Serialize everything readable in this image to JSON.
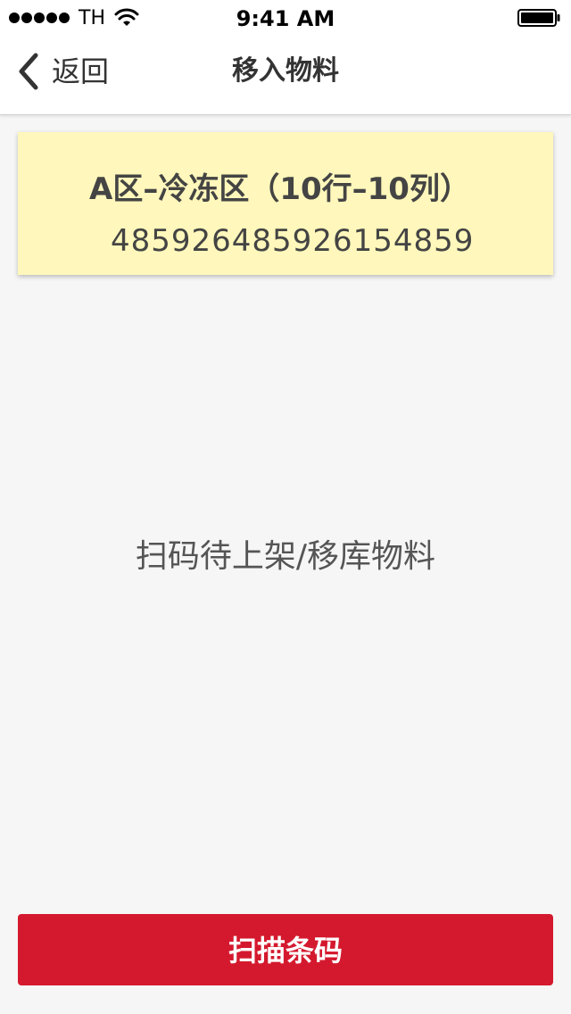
{
  "status_bar": {
    "carrier": "TH",
    "time": "9:41 AM"
  },
  "nav": {
    "back_label": "返回",
    "title": "移入物料"
  },
  "location": {
    "title": "A区–冷冻区（10行–10列）",
    "code": "485926485926154859"
  },
  "hint": "扫码待上架/移库物料",
  "scan_button_label": "扫描条码",
  "colors": {
    "card_bg": "#fff7bb",
    "primary": "#d4192e",
    "page_bg": "#f6f6f6"
  },
  "icons": {
    "back": "chevron-left-icon",
    "wifi": "wifi-icon",
    "battery": "battery-icon",
    "signal": "signal-dots-icon"
  }
}
